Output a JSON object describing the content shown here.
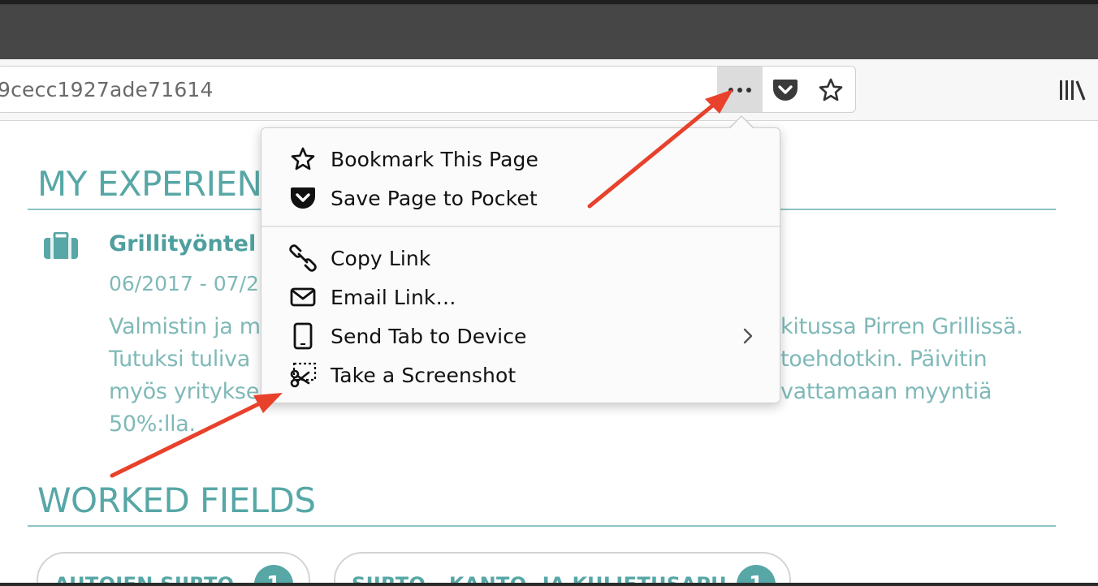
{
  "toolbar": {
    "url": "9cecc1927ade71614"
  },
  "page": {
    "experience_title": "MY EXPERIENC",
    "job_title": "Grillityöntel",
    "job_dates": "06/2017 - 07/2",
    "desc_left": [
      "Valmistin ja m",
      "Tutuksi tuliva",
      "myös yritykse",
      "50%:lla."
    ],
    "desc_right": [
      "kitussa Pirren Grillissä.",
      "toehdotkin. Päivitin",
      "vattamaan myyntiä"
    ],
    "desc_mid_fragment": "y",
    "worked_fields_title": "WORKED FIELDS",
    "tags": [
      {
        "label": "AUTOJEN SIIRTO",
        "count": "1"
      },
      {
        "label": "SIIRTO-, KANTO- JA KULJETUSAPU",
        "count": "1"
      }
    ]
  },
  "menu": {
    "items": [
      {
        "label": "Bookmark This Page",
        "icon": "star-outline-icon"
      },
      {
        "label": "Save Page to Pocket",
        "icon": "pocket-icon"
      },
      {
        "label": "Copy Link",
        "icon": "link-icon"
      },
      {
        "label": "Email Link…",
        "icon": "envelope-icon"
      },
      {
        "label": "Send Tab to Device",
        "icon": "mobile-device-icon"
      },
      {
        "label": "Take a Screenshot",
        "icon": "screenshot-scissors-icon"
      }
    ]
  },
  "colors": {
    "accent": "#57a7a6",
    "annotation": "#e8412c"
  }
}
